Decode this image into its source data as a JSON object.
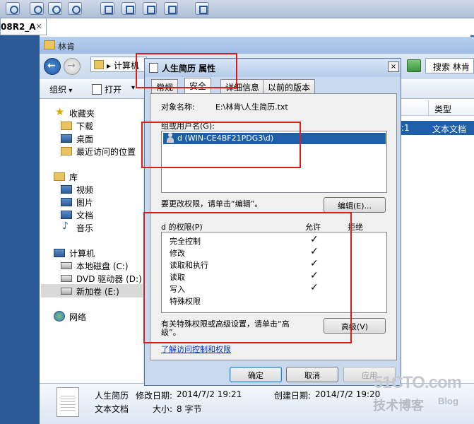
{
  "vm": {
    "tab_label": "08R2_A",
    "tab_close": "×"
  },
  "explorer": {
    "window_title": "林肯",
    "address": "▸ 计算机",
    "search_placeholder": "搜索 林肯",
    "toolbar": {
      "organize": "组织",
      "open": "打开",
      "open_arrow": "▾"
    },
    "nav": {
      "favorites": "收藏夹",
      "downloads": "下载",
      "desktop": "桌面",
      "recent": "最近访问的位置",
      "libraries": "库",
      "videos": "视频",
      "pictures": "图片",
      "documents": "文档",
      "music": "音乐",
      "computer": "计算机",
      "local_disk": "本地磁盘 (C:)",
      "dvd_drive": "DVD 驱动器 (D:)",
      "new_volume": "新加卷 (E:)",
      "network": "网络"
    },
    "columns": {
      "type": "类型"
    },
    "selected_row": {
      "partial_date": ":1",
      "type": "文本文档"
    },
    "details": {
      "name": "人生简历",
      "modified_label": "修改日期:",
      "modified_value": "2014/7/2 19:21",
      "created_label": "创建日期:",
      "created_value": "2014/7/2 19:20",
      "filetype": "文本文档",
      "size_label": "大小:",
      "size_value": "8 字节"
    }
  },
  "dialog": {
    "title": "人生简历 属性",
    "close": "×",
    "tabs": [
      "常规",
      "安全",
      "详细信息",
      "以前的版本"
    ],
    "active_tab": "安全",
    "object_label": "对象名称:",
    "object_value": "E:\\林肯\\人生简历.txt",
    "group_label": "组或用户名(G):",
    "user": "d (WIN-CE4BF21PDG3\\d)",
    "change_hint": "要更改权限，请单击“编辑”。",
    "edit_button": "编辑(E)...",
    "perm_label": "d 的权限(P)",
    "allow": "允许",
    "deny": "拒绝",
    "permissions": [
      {
        "name": "完全控制",
        "allow": "✓"
      },
      {
        "name": "修改",
        "allow": "✓"
      },
      {
        "name": "读取和执行",
        "allow": "✓"
      },
      {
        "name": "读取",
        "allow": "✓"
      },
      {
        "name": "写入",
        "allow": "✓"
      },
      {
        "name": "特殊权限",
        "allow": ""
      }
    ],
    "special_hint_1": "有关特殊权限或高级设置，请单击“高",
    "special_hint_2": "级”。",
    "advanced_button": "高级(V)",
    "learn_link": "了解访问控制和权限",
    "ok": "确定",
    "cancel": "取消",
    "apply": "应用"
  },
  "watermark": {
    "site": "51CTO.com",
    "sub": "技术博客",
    "blog": "Blog"
  }
}
